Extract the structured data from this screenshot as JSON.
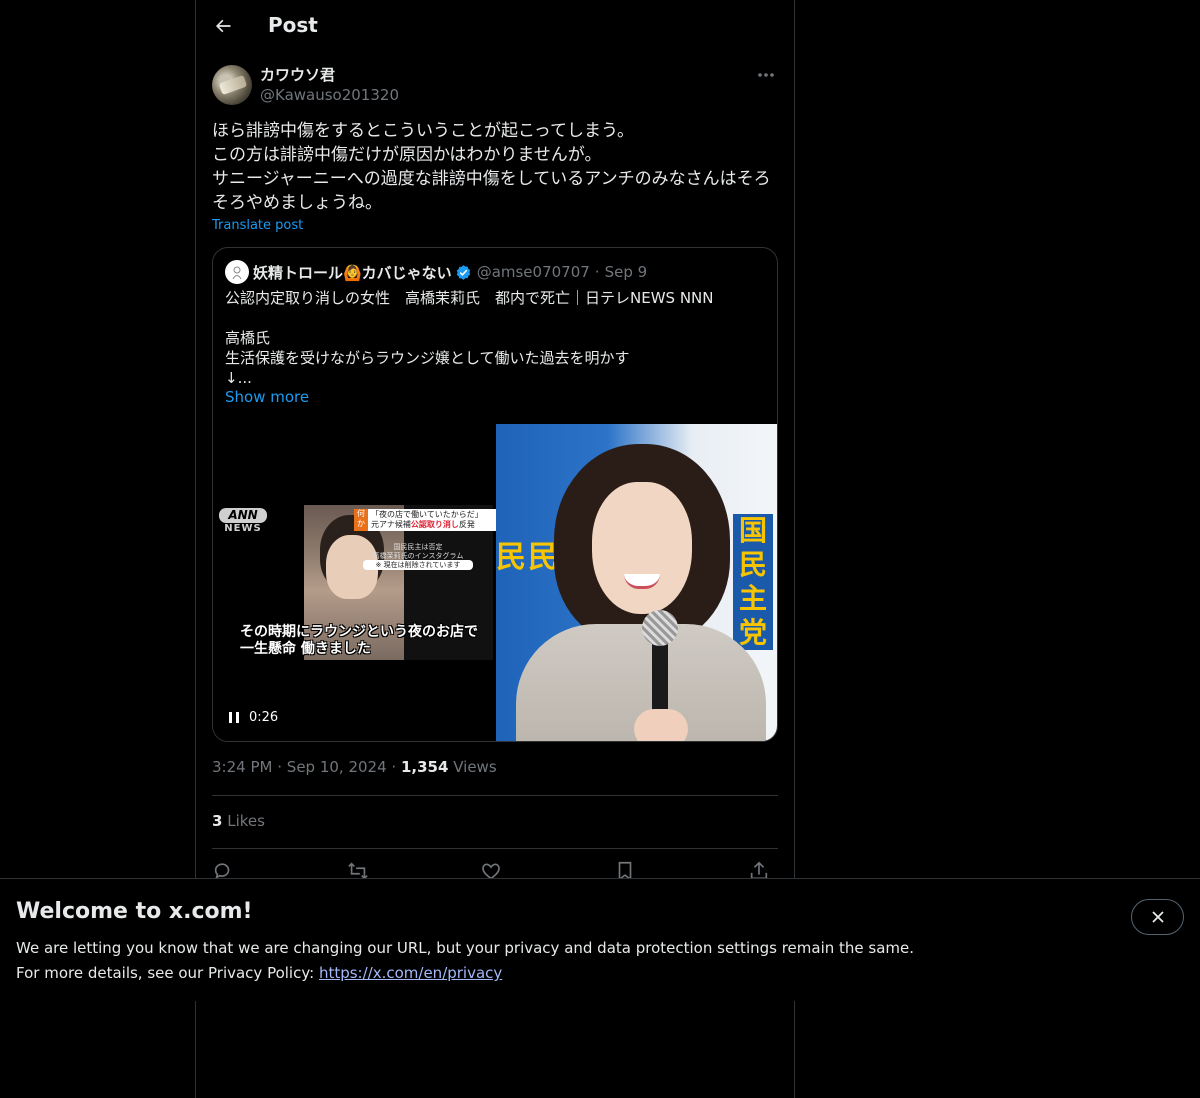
{
  "header": {
    "title": "Post"
  },
  "post": {
    "author": {
      "display_name": "カワウソ君",
      "handle": "@Kawauso201320"
    },
    "text_lines": [
      "ほら誹謗中傷をするとこういうことが起こってしまう。",
      "この方は誹謗中傷だけが原因かはわかりませんが。",
      "サニージャーニーへの過度な誹謗中傷をしているアンチのみなさんはそろ",
      "そろやめましょうね。"
    ],
    "translate_label": "Translate post",
    "quote": {
      "display_name": "妖精トロール🙆カバじゃない",
      "handle": "@amse070707",
      "separator": "·",
      "date": "Sep 9",
      "text_lines": [
        "公認内定取り消しの女性　高橋茉莉氏　都内で死亡｜日テレNEWS NNN",
        "",
        "高橋氏",
        "生活保護を受けながらラウンジ嬢として働いた過去を明かす",
        "↓..."
      ],
      "show_more_label": "Show more",
      "video": {
        "logo_top": "ANN",
        "logo_bottom": "NEWS",
        "tag_prefix": "何か",
        "tag_line1": "「夜の店で働いていたからだ」",
        "tag_line2_a": "元アナ候補",
        "tag_line2_b": "公認取り消し",
        "tag_line2_c": "反発",
        "sub_line1": "国民民主は否定",
        "sub_line2": "高橋茉莉氏のインスタグラム",
        "sub_line3": "※ 現在は削除されています",
        "subtitle_line1": "その時期にラウンジという夜のお店で",
        "subtitle_line2": "一生懸命 働きました",
        "duration": "0:26"
      },
      "photo": {
        "sign_left": "民民主",
        "sign_right": "国民主党"
      }
    },
    "meta": {
      "time": "3:24 PM",
      "separator": "·",
      "date": "Sep 10, 2024",
      "views_count": "1,354",
      "views_label": "Views"
    },
    "likes": {
      "count": "3",
      "label": "Likes"
    }
  },
  "banner": {
    "title": "Welcome to x.com!",
    "line1": "We are letting you know that we are changing our URL, but your privacy and data protection settings remain the same.",
    "line2_prefix": "For more details, see our Privacy Policy: ",
    "link": "https://x.com/en/privacy"
  },
  "colors": {
    "background": "#000000",
    "text": "#e7e9ea",
    "muted": "#71767b",
    "accent": "#1d9bf0",
    "border": "#2f3336",
    "link": "#a2b8f9"
  },
  "icons": {
    "back": "arrow-left-icon",
    "more": "more-dots-icon",
    "verified": "verified-badge-icon",
    "pause": "pause-icon",
    "reply": "reply-icon",
    "repost": "repost-icon",
    "like": "heart-icon",
    "bookmark": "bookmark-icon",
    "share": "share-icon",
    "close": "close-icon"
  }
}
